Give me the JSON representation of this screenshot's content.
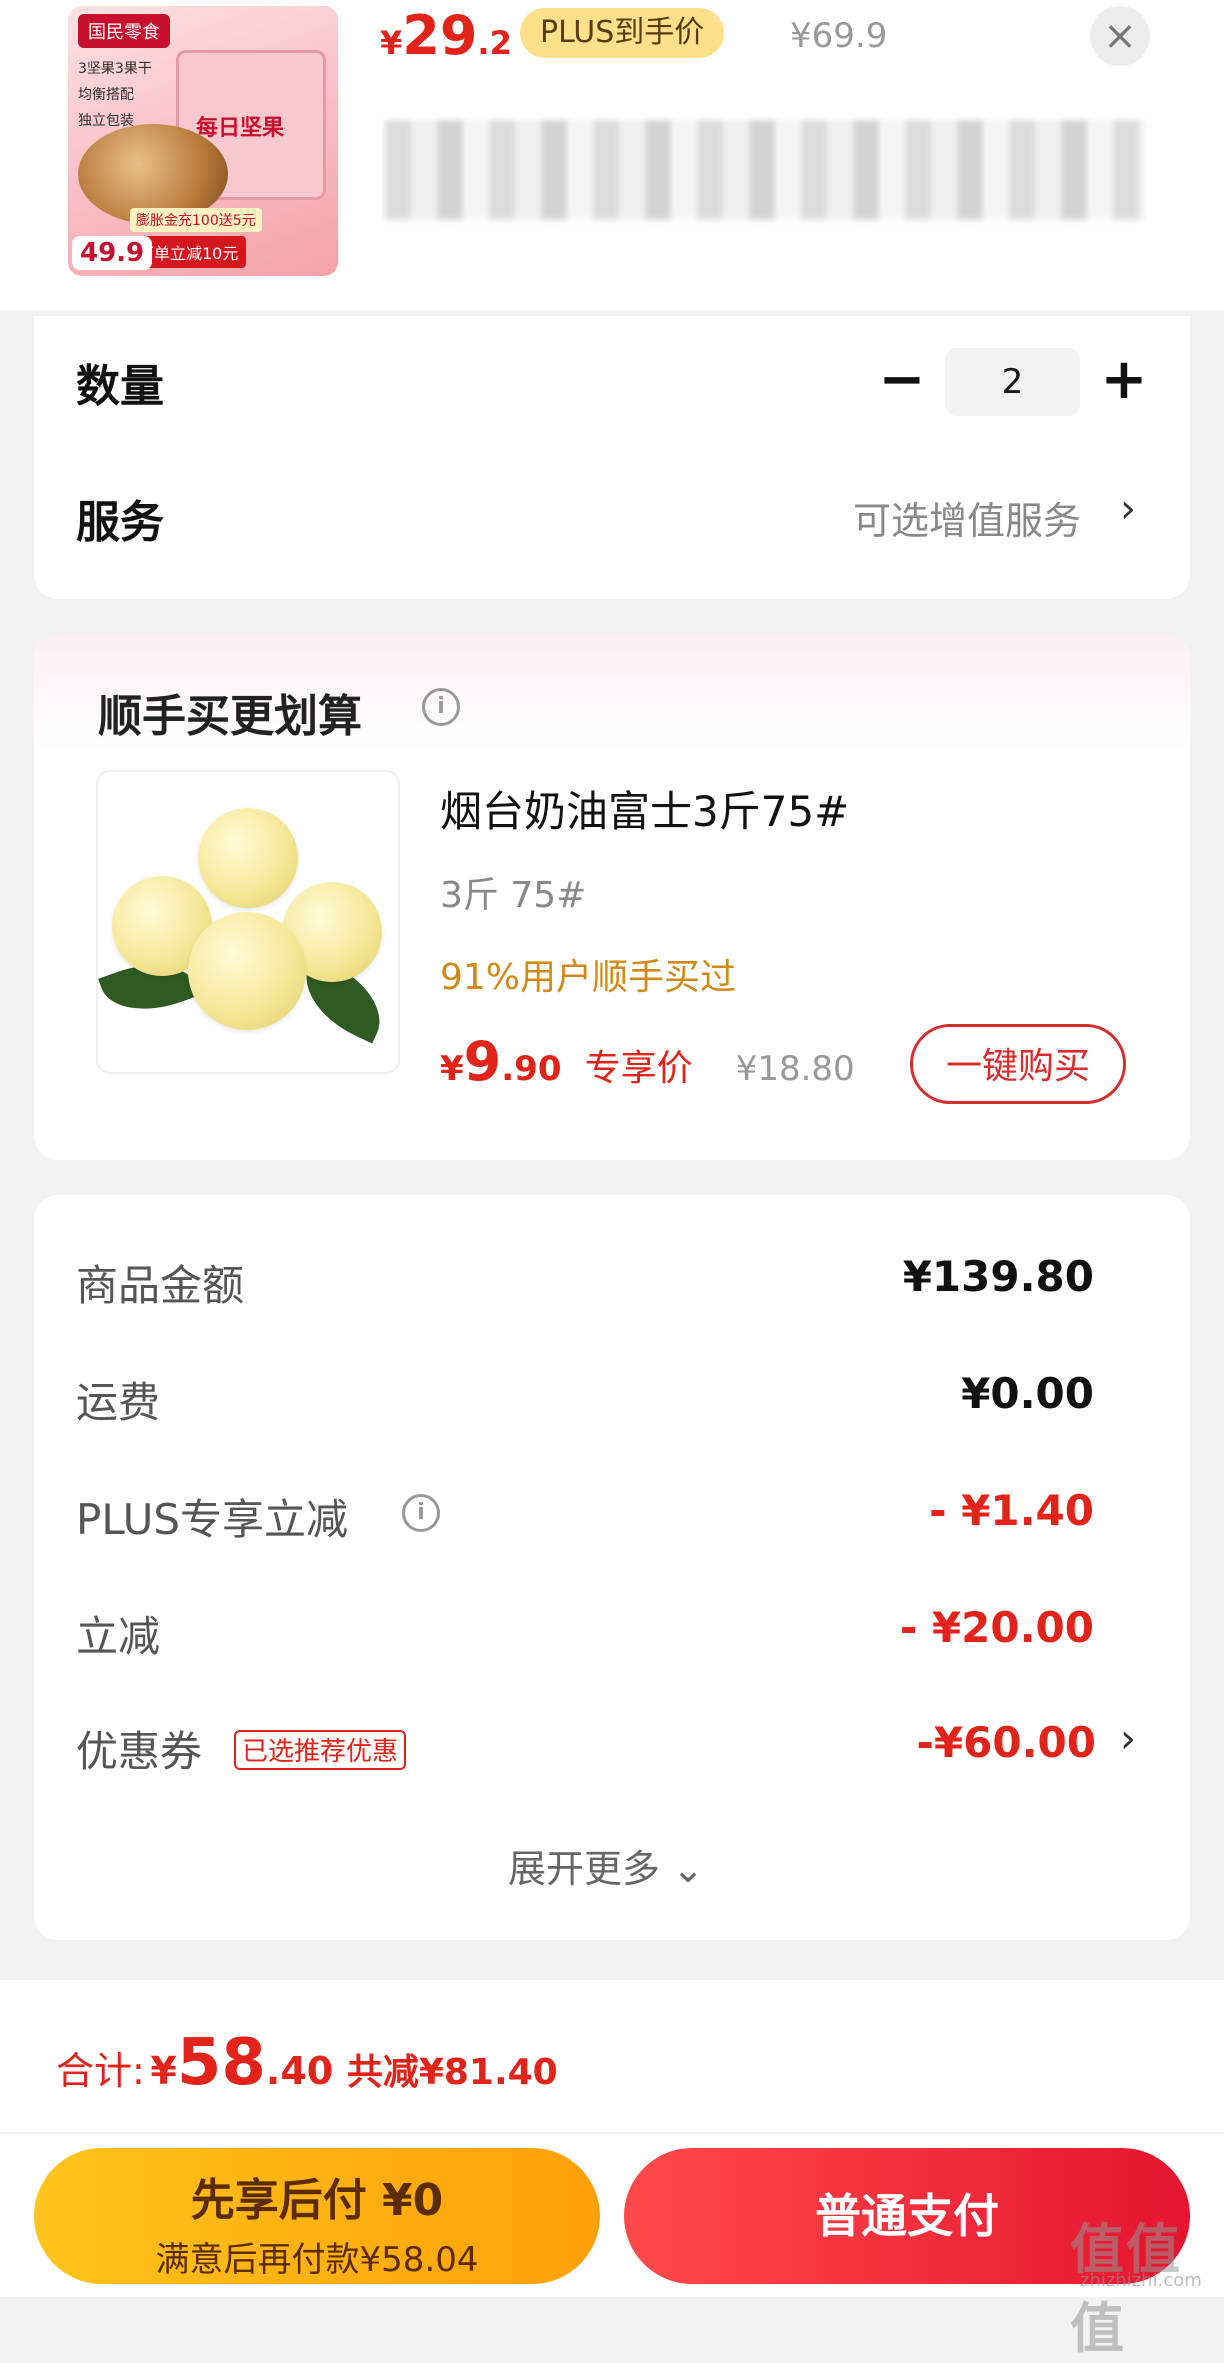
{
  "header": {
    "thumb": {
      "brand": "国民零食",
      "box_title": "每日坚果",
      "features": [
        "3坚果3果干",
        "均衡搭配",
        "独立包装"
      ],
      "price_badge": "49.9",
      "promo_small": "膨胀金充100送5元",
      "promo_big": "下单立减10元"
    },
    "price_symbol": "¥",
    "price_int": "29",
    "price_dec": ".2",
    "plus_badge": "PLUS到手价",
    "original_price": "¥69.9",
    "close_icon": "×"
  },
  "options": {
    "quantity_label": "数量",
    "quantity_value": "2",
    "minus": "−",
    "plus": "+",
    "service_label": "服务",
    "service_hint": "可选增值服务",
    "chevron": "›"
  },
  "upsell": {
    "title": "顺手买更划算",
    "info_icon": "i",
    "product_name": "烟台奶油富士3斤75#",
    "product_spec": "3斤 75#",
    "bought_text": "91%用户顺手买过",
    "price_symbol": "¥",
    "price_int": "9",
    "price_dec": ".90",
    "price_tag": "专享价",
    "old_price": "¥18.80",
    "buy_button": "一键购买"
  },
  "summary": {
    "rows": [
      {
        "label": "商品金额",
        "value": "¥139.80"
      },
      {
        "label": "运费",
        "value": "¥0.00"
      },
      {
        "label": "PLUS专享立减",
        "value": "- ¥1.40"
      },
      {
        "label": "立减",
        "value": "- ¥20.00"
      },
      {
        "label": "优惠券",
        "value": "-¥60.00"
      }
    ],
    "coupon_tag": "已选推荐优惠",
    "expand_more": "展开更多 ⌄"
  },
  "bottom": {
    "total_label": "合计:",
    "total_symbol": "¥",
    "total_int": "58",
    "total_dec": ".40",
    "saved_text": "共减¥81.40",
    "pay_later_title": "先享后付 ¥0",
    "pay_later_sub": "满意后再付款¥58.04",
    "pay_normal": "普通支付"
  },
  "watermark": {
    "text": "值值值",
    "sub": "zhizhizhi.com"
  }
}
